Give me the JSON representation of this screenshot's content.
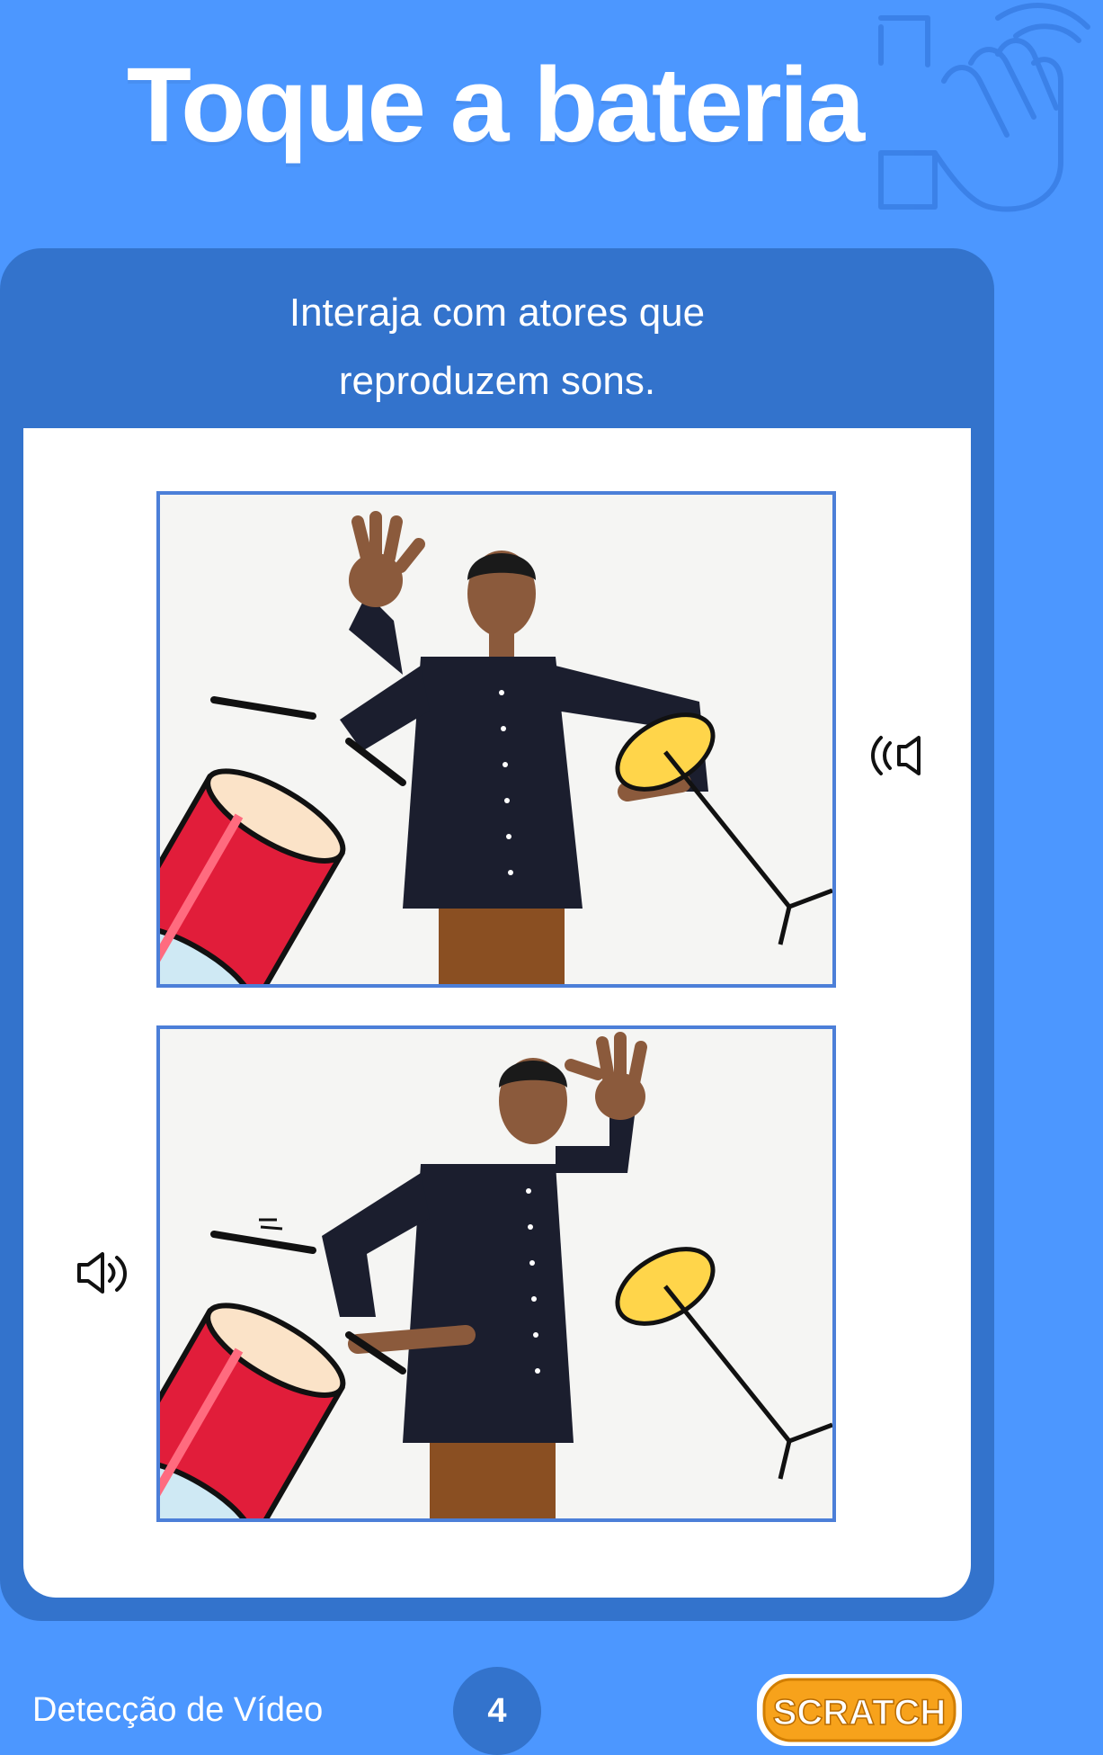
{
  "header": {
    "title": "Toque a bateria"
  },
  "card": {
    "description_line1": "Interaja com atores que",
    "description_line2": "reproduzem sons."
  },
  "images": [
    {
      "name": "frame-hand-on-cymbal",
      "speaker_icon": "speaker-sound-icon"
    },
    {
      "name": "frame-hand-on-drum",
      "speaker_icon": "speaker-sound-icon"
    }
  ],
  "footer": {
    "label": "Detecção de Vídeo",
    "page_number": "4",
    "logo_text": "SCRATCH"
  },
  "colors": {
    "background": "#4c97ff",
    "card": "#3373cc",
    "drum_red": "#e11d3a",
    "cymbal_yellow": "#ffd54a",
    "logo_orange": "#f7a21b"
  }
}
